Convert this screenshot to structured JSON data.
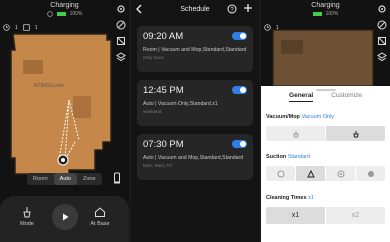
{
  "map_screen": {
    "status_title": "Charging",
    "battery": "100%",
    "info_area": "1",
    "info_time": "1",
    "watermark": "RTINGS.com",
    "modes": [
      "Room",
      "Auto",
      "Zone"
    ],
    "active_mode": "Auto",
    "bottom": {
      "mode_label": "Mode",
      "base_label": "At Base"
    }
  },
  "schedule": {
    "title": "Schedule",
    "items": [
      {
        "time": "09:20 AM",
        "desc": "Room | Vacuum and Mop,Standard,Standard",
        "freq": "Only once",
        "enabled": true
      },
      {
        "time": "12:45 PM",
        "desc": "Auto | Vacuum Only,Standard,x1",
        "freq": "weekend",
        "enabled": true
      },
      {
        "time": "07:30 PM",
        "desc": "Auto | Vacuum and Mop,Standard,Standard",
        "freq": "Mon, Wed, Fri",
        "enabled": true
      }
    ]
  },
  "settings": {
    "status_title": "Charging",
    "battery": "100%",
    "info_area": "1",
    "tabs": [
      "General",
      "Customize"
    ],
    "active_tab": "General",
    "vacuum_mop": {
      "label": "Vacuum/Mop",
      "value": "Vacuum Only"
    },
    "suction": {
      "label": "Suction",
      "value": "Standard"
    },
    "cleaning_times": {
      "label": "Cleaning Times",
      "value": "x1",
      "options": [
        "x1",
        "x2"
      ]
    }
  },
  "colors": {
    "accent": "#2f7ee8",
    "map_fill": "#c6874a",
    "battery": "#3fcf4a"
  }
}
